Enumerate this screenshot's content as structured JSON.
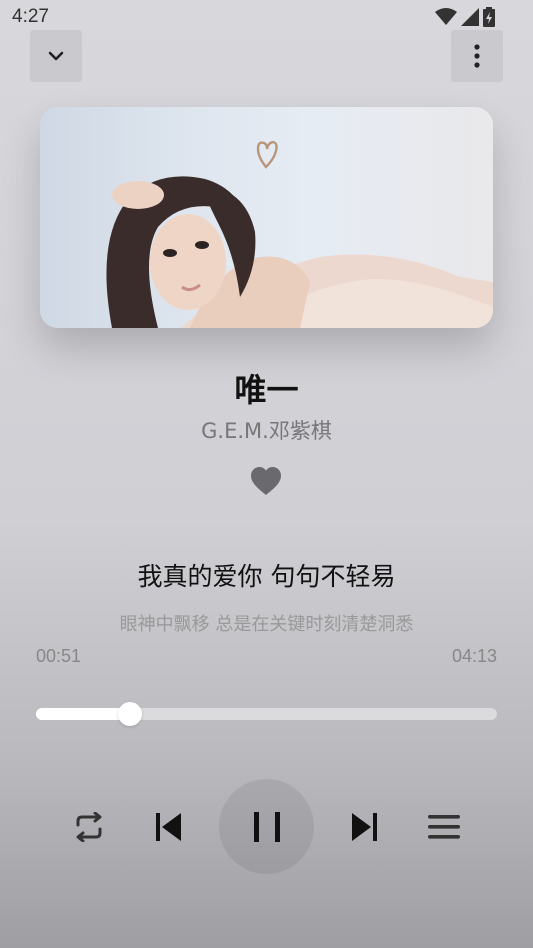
{
  "status_bar": {
    "time": "4:27",
    "icons": [
      "wifi-icon",
      "cell-signal-icon",
      "battery-charging-icon"
    ]
  },
  "header": {
    "collapse_icon": "chevron-down-icon",
    "menu_icon": "more-vertical-icon"
  },
  "song": {
    "title": "唯一",
    "artist": "G.E.M.邓紫棋",
    "liked": true
  },
  "lyrics": {
    "current": "我真的爱你 句句不轻易",
    "next": "眼神中飘移 总是在关键时刻清楚洞悉"
  },
  "progress": {
    "current_time": "00:51",
    "total_time": "04:13",
    "fraction": 0.203
  },
  "controls": [
    "repeat-icon",
    "skip-previous-icon",
    "pause-icon",
    "skip-next-icon",
    "playlist-icon"
  ],
  "colors": {
    "accent": "#ffffff",
    "icon": "#222222",
    "muted_text": "#777777"
  }
}
